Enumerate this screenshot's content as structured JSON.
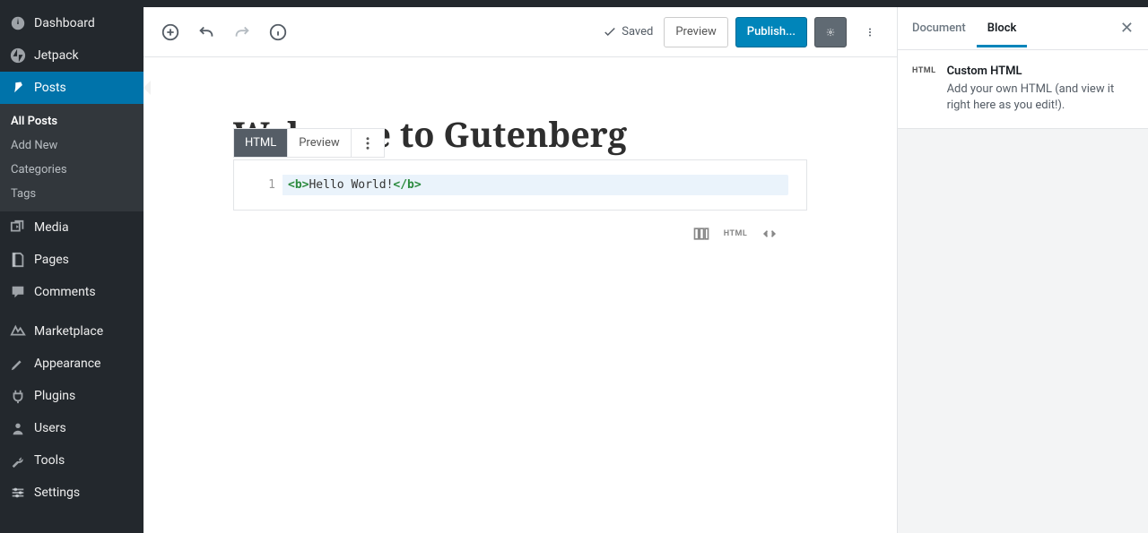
{
  "sidebar": {
    "items": [
      {
        "label": "Dashboard"
      },
      {
        "label": "Jetpack"
      },
      {
        "label": "Posts"
      },
      {
        "label": "Media"
      },
      {
        "label": "Pages"
      },
      {
        "label": "Comments"
      },
      {
        "label": "Marketplace"
      },
      {
        "label": "Appearance"
      },
      {
        "label": "Plugins"
      },
      {
        "label": "Users"
      },
      {
        "label": "Tools"
      },
      {
        "label": "Settings"
      }
    ],
    "submenu": [
      {
        "label": "All Posts"
      },
      {
        "label": "Add New"
      },
      {
        "label": "Categories"
      },
      {
        "label": "Tags"
      }
    ]
  },
  "header": {
    "saved": "Saved",
    "preview": "Preview",
    "publish": "Publish..."
  },
  "post": {
    "title": "Welcome to Gutenberg"
  },
  "block": {
    "tab_html": "HTML",
    "tab_preview": "Preview",
    "line_number": "1",
    "code_open": "<b>",
    "code_text": "Hello World!",
    "code_close": "</b>",
    "html_label": "HTML"
  },
  "settings": {
    "tab_document": "Document",
    "tab_block": "Block",
    "panel_icon": "HTML",
    "panel_title": "Custom HTML",
    "panel_desc": "Add your own HTML (and view it right here as you edit!)."
  }
}
